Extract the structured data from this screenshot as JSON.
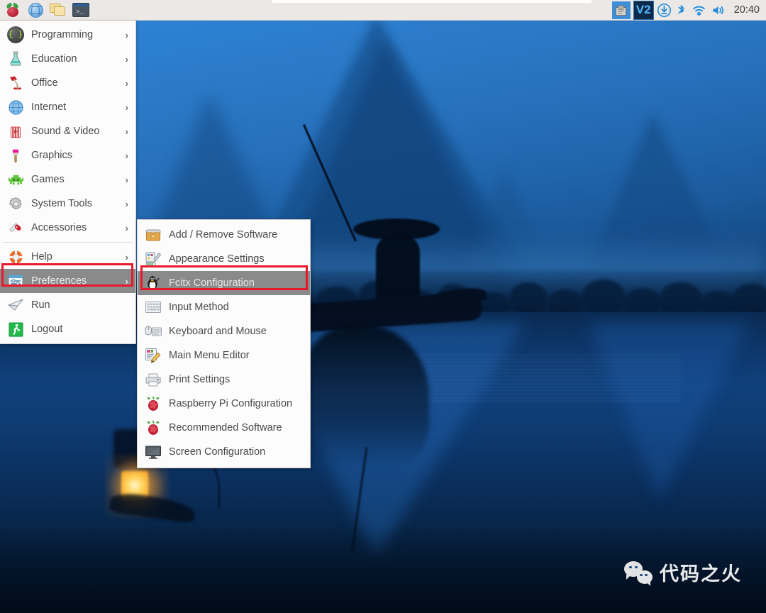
{
  "taskbar": {
    "launchers": [
      {
        "name": "raspberry-menu-button",
        "icon": "raspberry-pi-icon",
        "label": "Raspberry Pi Menu"
      },
      {
        "name": "web-browser-button",
        "icon": "globe-icon",
        "label": "Web Browser"
      },
      {
        "name": "file-manager-button",
        "icon": "folders-icon",
        "label": "File Manager"
      },
      {
        "name": "terminal-button",
        "icon": "terminal-icon",
        "label": "Terminal"
      }
    ],
    "tray": [
      {
        "name": "ejector-tray-icon",
        "icon": "eject-media-icon",
        "label": "Removable Media"
      },
      {
        "name": "v2ray-tray-icon",
        "icon": "v2-icon",
        "label": "V2"
      },
      {
        "name": "updates-tray-icon",
        "icon": "download-arrow-icon",
        "label": "Updater"
      },
      {
        "name": "bluetooth-tray-icon",
        "icon": "bluetooth-icon",
        "label": "Bluetooth"
      },
      {
        "name": "wifi-tray-icon",
        "icon": "wifi-icon",
        "label": "Wireless Network"
      },
      {
        "name": "volume-tray-icon",
        "icon": "speaker-icon",
        "label": "Volume"
      }
    ],
    "clock": "20:40"
  },
  "main_menu": {
    "items": [
      {
        "label": "Programming",
        "icon": "code-braces-icon",
        "has_submenu": true,
        "selected": false
      },
      {
        "label": "Education",
        "icon": "flask-icon",
        "has_submenu": true,
        "selected": false
      },
      {
        "label": "Office",
        "icon": "desk-lamp-icon",
        "has_submenu": true,
        "selected": false
      },
      {
        "label": "Internet",
        "icon": "globe-icon",
        "has_submenu": true,
        "selected": false
      },
      {
        "label": "Sound & Video",
        "icon": "popcorn-icon",
        "has_submenu": true,
        "selected": false
      },
      {
        "label": "Graphics",
        "icon": "paintbrush-icon",
        "has_submenu": true,
        "selected": false
      },
      {
        "label": "Games",
        "icon": "space-invader-icon",
        "has_submenu": true,
        "selected": false
      },
      {
        "label": "System Tools",
        "icon": "gear-icon",
        "has_submenu": true,
        "selected": false
      },
      {
        "label": "Accessories",
        "icon": "swiss-knife-icon",
        "has_submenu": true,
        "selected": false
      },
      {
        "label": "Help",
        "icon": "life-ring-icon",
        "has_submenu": true,
        "selected": false
      },
      {
        "label": "Preferences",
        "icon": "sliders-panel-icon",
        "has_submenu": true,
        "selected": true
      },
      {
        "label": "Run",
        "icon": "paper-plane-icon",
        "has_submenu": false,
        "selected": false
      },
      {
        "label": "Logout",
        "icon": "running-person-icon",
        "has_submenu": false,
        "selected": false
      }
    ],
    "arrow_glyph": "›"
  },
  "sub_menu": {
    "parent": "Preferences",
    "items": [
      {
        "label": "Add / Remove Software",
        "icon": "briefcase-icon",
        "selected": false
      },
      {
        "label": "Appearance Settings",
        "icon": "palette-icon",
        "selected": false
      },
      {
        "label": "Fcitx Configuration",
        "icon": "tux-penguin-icon",
        "selected": true
      },
      {
        "label": "Input Method",
        "icon": "keyboard-grid-icon",
        "selected": false
      },
      {
        "label": "Keyboard and Mouse",
        "icon": "mouse-keyboard-icon",
        "selected": false
      },
      {
        "label": "Main Menu Editor",
        "icon": "menu-pencil-icon",
        "selected": false
      },
      {
        "label": "Print Settings",
        "icon": "printer-icon",
        "selected": false
      },
      {
        "label": "Raspberry Pi Configuration",
        "icon": "raspberry-pi-icon",
        "selected": false
      },
      {
        "label": "Recommended Software",
        "icon": "raspberry-pi-icon",
        "selected": false
      },
      {
        "label": "Screen Configuration",
        "icon": "monitor-icon",
        "selected": false
      }
    ]
  },
  "annotations": {
    "highlight_color": "#e8192c",
    "boxes": [
      {
        "name": "preferences-highlight-box",
        "target": "Preferences"
      },
      {
        "name": "fcitx-configuration-highlight-box",
        "target": "Fcitx Configuration"
      }
    ]
  },
  "watermark": {
    "text": "代码之火",
    "icon": "wechat-logo-icon"
  },
  "desktop": {
    "wallpaper_description": "Misty blue karst mountain river scene with fisherman on bamboo raft and glowing lantern",
    "colors": {
      "sky": "#2b7ac8",
      "water": "#0d3567",
      "taskbar": "#ebe8e6",
      "menu_bg": "#fcfcfc",
      "menu_text": "#4a4a4a",
      "menu_selected_bg": "#8a8a8a"
    }
  }
}
